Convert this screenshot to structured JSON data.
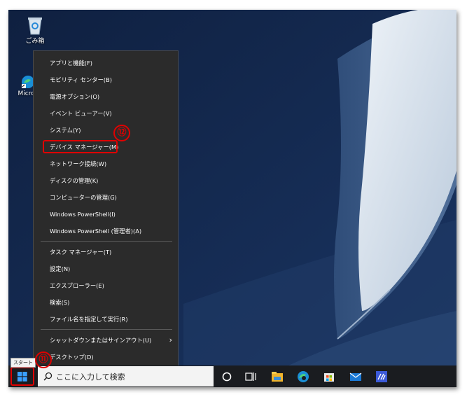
{
  "desktop": {
    "recycle_bin_label": "ごみ箱",
    "edge_label": "Micros"
  },
  "winx_menu": {
    "items": [
      {
        "label": "アプリと機能(F)"
      },
      {
        "label": "モビリティ センター(B)"
      },
      {
        "label": "電源オプション(O)"
      },
      {
        "label": "イベント ビューアー(V)"
      },
      {
        "label": "システム(Y)"
      },
      {
        "label": "デバイス マネージャー(M)",
        "highlighted": true
      },
      {
        "label": "ネットワーク接続(W)"
      },
      {
        "label": "ディスクの管理(K)"
      },
      {
        "label": "コンピューターの管理(G)"
      },
      {
        "label": "Windows PowerShell(I)"
      },
      {
        "label": "Windows PowerShell (管理者)(A)"
      },
      {
        "label": "タスク マネージャー(T)"
      },
      {
        "label": "設定(N)"
      },
      {
        "label": "エクスプローラー(E)"
      },
      {
        "label": "検索(S)"
      },
      {
        "label": "ファイル名を指定して実行(R)"
      },
      {
        "label": "シャットダウンまたはサインアウト(U)",
        "submenu": true
      },
      {
        "label": "デスクトップ(D)"
      }
    ],
    "submenu_arrow": "›"
  },
  "annotations": {
    "step_start": "⑪",
    "step_device_manager": "⑫",
    "highlight_color": "#e00000"
  },
  "taskbar": {
    "start_tooltip": "スタート",
    "search_placeholder": "ここに入力して検索",
    "icons": [
      "cortana-icon",
      "task-view-icon",
      "file-explorer-icon",
      "edge-icon",
      "store-icon",
      "mail-icon",
      "app-icon"
    ]
  }
}
